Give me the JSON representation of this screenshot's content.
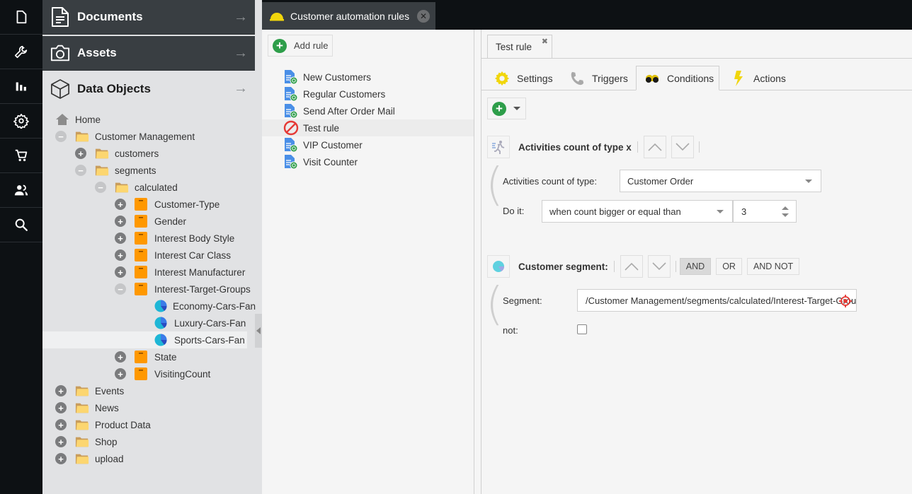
{
  "rail": {
    "items": [
      {
        "name": "documents",
        "icon": "document-icon"
      },
      {
        "name": "tools",
        "icon": "wrench-icon"
      },
      {
        "name": "reports",
        "icon": "bar-chart-icon"
      },
      {
        "name": "settings",
        "icon": "gear-icon"
      },
      {
        "name": "ecommerce",
        "icon": "cart-icon"
      },
      {
        "name": "users",
        "icon": "users-icon"
      },
      {
        "name": "search",
        "icon": "search-icon"
      }
    ]
  },
  "accordion": {
    "documents": "Documents",
    "assets": "Assets",
    "data_objects": "Data Objects",
    "arrow": "→"
  },
  "tree": [
    {
      "label": "Home",
      "type": "home",
      "depth": 0,
      "toggle": "none"
    },
    {
      "label": "Customer Management",
      "type": "folder",
      "depth": 0,
      "toggle": "minus"
    },
    {
      "label": "customers",
      "type": "folder",
      "depth": 1,
      "toggle": "plus"
    },
    {
      "label": "segments",
      "type": "folder",
      "depth": 1,
      "toggle": "minus"
    },
    {
      "label": "calculated",
      "type": "folder",
      "depth": 2,
      "toggle": "minus"
    },
    {
      "label": "Customer-Type",
      "type": "segment-group",
      "depth": 3,
      "toggle": "plus"
    },
    {
      "label": "Gender",
      "type": "segment-group",
      "depth": 3,
      "toggle": "plus"
    },
    {
      "label": "Interest Body Style",
      "type": "segment-group",
      "depth": 3,
      "toggle": "plus"
    },
    {
      "label": "Interest Car Class",
      "type": "segment-group",
      "depth": 3,
      "toggle": "plus"
    },
    {
      "label": "Interest Manufacturer",
      "type": "segment-group",
      "depth": 3,
      "toggle": "plus"
    },
    {
      "label": "Interest-Target-Groups",
      "type": "segment-group",
      "depth": 3,
      "toggle": "minus"
    },
    {
      "label": "Economy-Cars-Fan",
      "type": "segment",
      "depth": 4,
      "toggle": "none"
    },
    {
      "label": "Luxury-Cars-Fan",
      "type": "segment",
      "depth": 4,
      "toggle": "none"
    },
    {
      "label": "Sports-Cars-Fan",
      "type": "segment",
      "depth": 4,
      "toggle": "none",
      "selected": true
    },
    {
      "label": "State",
      "type": "segment-group",
      "depth": 3,
      "toggle": "plus"
    },
    {
      "label": "VisitingCount",
      "type": "segment-group",
      "depth": 3,
      "toggle": "plus"
    },
    {
      "label": "Events",
      "type": "folder",
      "depth": 0,
      "toggle": "plus"
    },
    {
      "label": "News",
      "type": "folder",
      "depth": 0,
      "toggle": "plus"
    },
    {
      "label": "Product Data",
      "type": "folder",
      "depth": 0,
      "toggle": "plus"
    },
    {
      "label": "Shop",
      "type": "folder",
      "depth": 0,
      "toggle": "plus"
    },
    {
      "label": "upload",
      "type": "folder",
      "depth": 0,
      "toggle": "plus"
    }
  ],
  "main_tab": {
    "label": "Customer automation rules",
    "close": "✕"
  },
  "rules_panel": {
    "add_rule": "Add rule",
    "rules": [
      {
        "label": "New Customers",
        "status": "active"
      },
      {
        "label": "Regular Customers",
        "status": "active"
      },
      {
        "label": "Send After Order Mail",
        "status": "active"
      },
      {
        "label": "Test rule",
        "status": "inactive",
        "selected": true
      },
      {
        "label": "VIP Customer",
        "status": "active"
      },
      {
        "label": "Visit Counter",
        "status": "active"
      }
    ]
  },
  "editor": {
    "rule_tab": {
      "label": "Test rule",
      "close": "✖"
    },
    "tabs": [
      {
        "label": "Settings",
        "icon": "gear-icon"
      },
      {
        "label": "Triggers",
        "icon": "phone-icon"
      },
      {
        "label": "Conditions",
        "icon": "binoculars-icon",
        "active": true
      },
      {
        "label": "Actions",
        "icon": "lightning-icon"
      }
    ],
    "condition1": {
      "title": "Activities count of type x",
      "type_label": "Activities count of type:",
      "type_value": "Customer Order",
      "doit_label": "Do it:",
      "doit_value": "when count bigger or equal than",
      "count_value": "3"
    },
    "condition2": {
      "title": "Customer segment:",
      "operators": [
        {
          "label": "AND",
          "active": true
        },
        {
          "label": "OR",
          "active": false
        },
        {
          "label": "AND NOT",
          "active": false
        }
      ],
      "segment_label": "Segment:",
      "segment_value": "/Customer Management/segments/calculated/Interest-Target-Groups/Sports-Cars-Fan",
      "not_label": "not:",
      "not_checked": false
    }
  }
}
